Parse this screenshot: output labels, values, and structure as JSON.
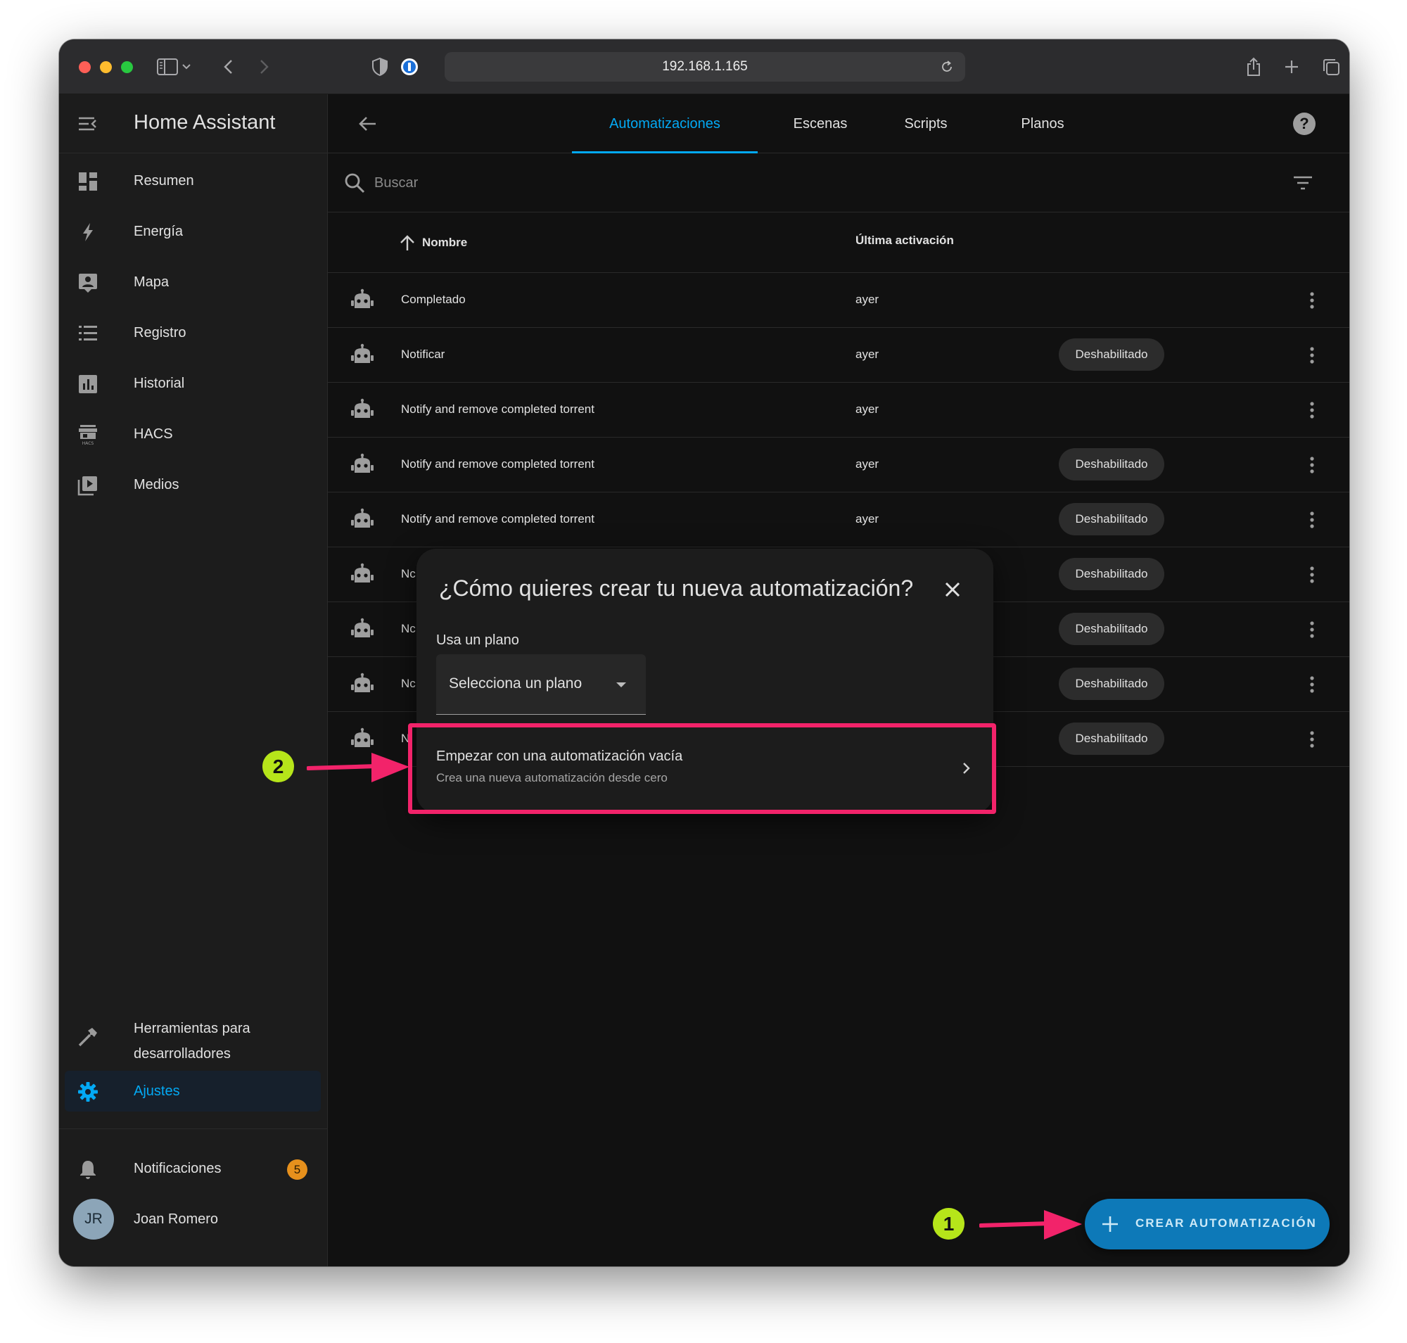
{
  "browser": {
    "url": "192.168.1.165"
  },
  "sidebar": {
    "title": "Home Assistant",
    "items": [
      {
        "label": "Resumen",
        "icon": "dashboard-icon"
      },
      {
        "label": "Energía",
        "icon": "lightning-icon"
      },
      {
        "label": "Mapa",
        "icon": "map-account-icon"
      },
      {
        "label": "Registro",
        "icon": "list-icon"
      },
      {
        "label": "Historial",
        "icon": "chart-box-icon"
      },
      {
        "label": "HACS",
        "icon": "hacs-store-icon"
      },
      {
        "label": "Medios",
        "icon": "play-box-multiple-icon"
      }
    ],
    "dev_tools_line1": "Herramientas para",
    "dev_tools_line2": "desarrolladores",
    "settings_label": "Ajustes",
    "notifications_label": "Notificaciones",
    "notifications_count": "5",
    "user_initials": "JR",
    "user_name": "Joan Romero"
  },
  "topbar": {
    "tabs": [
      {
        "label": "Automatizaciones",
        "active": true
      },
      {
        "label": "Escenas",
        "active": false
      },
      {
        "label": "Scripts",
        "active": false
      },
      {
        "label": "Planos",
        "active": false
      }
    ],
    "help": "?"
  },
  "search": {
    "placeholder": "Buscar"
  },
  "table": {
    "columns": [
      "Nombre",
      "Última activación"
    ],
    "rows": [
      {
        "name": "Completado",
        "last": "ayer",
        "status": ""
      },
      {
        "name": "Notificar",
        "last": "ayer",
        "status": "Deshabilitado"
      },
      {
        "name": "Notify and remove completed torrent",
        "last": "ayer",
        "status": ""
      },
      {
        "name": "Notify and remove completed torrent",
        "last": "ayer",
        "status": "Deshabilitado"
      },
      {
        "name": "Notify and remove completed torrent",
        "last": "ayer",
        "status": "Deshabilitado"
      },
      {
        "name": "Nc",
        "last": "",
        "status": "Deshabilitado"
      },
      {
        "name": "Nc",
        "last": "",
        "status": "Deshabilitado"
      },
      {
        "name": "Nc",
        "last": "",
        "status": "Deshabilitado"
      },
      {
        "name": "N",
        "last": "",
        "status": "Deshabilitado"
      }
    ]
  },
  "dialog": {
    "title": "¿Cómo quieres crear tu nueva automatización?",
    "blueprint_label": "Usa un plano",
    "blueprint_select": "Selecciona un plano",
    "option_title": "Empezar con una automatización vacía",
    "option_subtitle": "Crea una nueva automatización desde cero"
  },
  "fab": {
    "label": "CREAR AUTOMATIZACIÓN"
  },
  "annotations": {
    "step1": "1",
    "step2": "2",
    "color": "#f2236a",
    "badge_color": "#b6e51a"
  },
  "colors": {
    "accent": "#03a9f4",
    "background": "#111111",
    "sidebar": "#1c1c1c",
    "badge": "#e6901c"
  }
}
